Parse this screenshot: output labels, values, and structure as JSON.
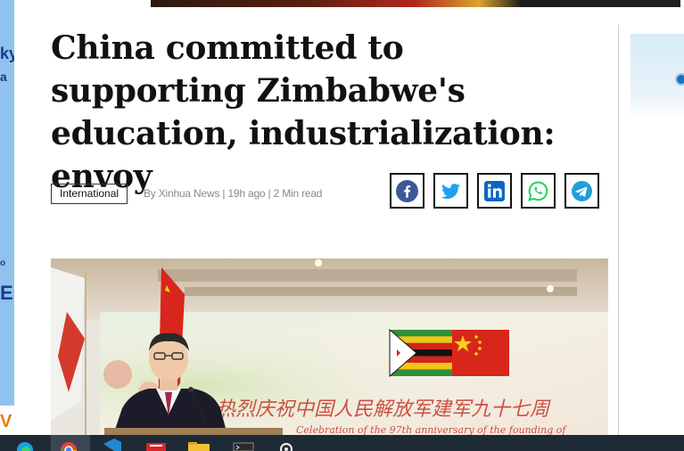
{
  "article": {
    "headline": "China committed to supporting Zimbabwe's education, industrialization: envoy",
    "category": "International",
    "byline": "By Xinhua News | 19h ago | 2 Min read"
  },
  "share": {
    "buttons": [
      {
        "name": "facebook",
        "color": "#3b5998"
      },
      {
        "name": "twitter",
        "color": "#1da1f2"
      },
      {
        "name": "linkedin",
        "color": "#0a66c2"
      },
      {
        "name": "whatsapp",
        "color": "#25d366"
      },
      {
        "name": "telegram",
        "color": "#229ed9"
      }
    ]
  },
  "photo": {
    "banner_text_cn": "热烈庆祝中国人民解放军建军九十七周",
    "banner_text_en": "Celebration of the 97th anniversary of the founding of"
  },
  "taskbar": {
    "apps": [
      "edge-icon",
      "chrome-icon",
      "vscode-icon",
      "red-app-icon",
      "file-explorer-icon",
      "terminal-icon",
      "settings-icon"
    ]
  },
  "colors": {
    "left_ad_bg": "#8fc3ee",
    "taskbar_bg": "#1e2a36",
    "headline": "#111111"
  }
}
